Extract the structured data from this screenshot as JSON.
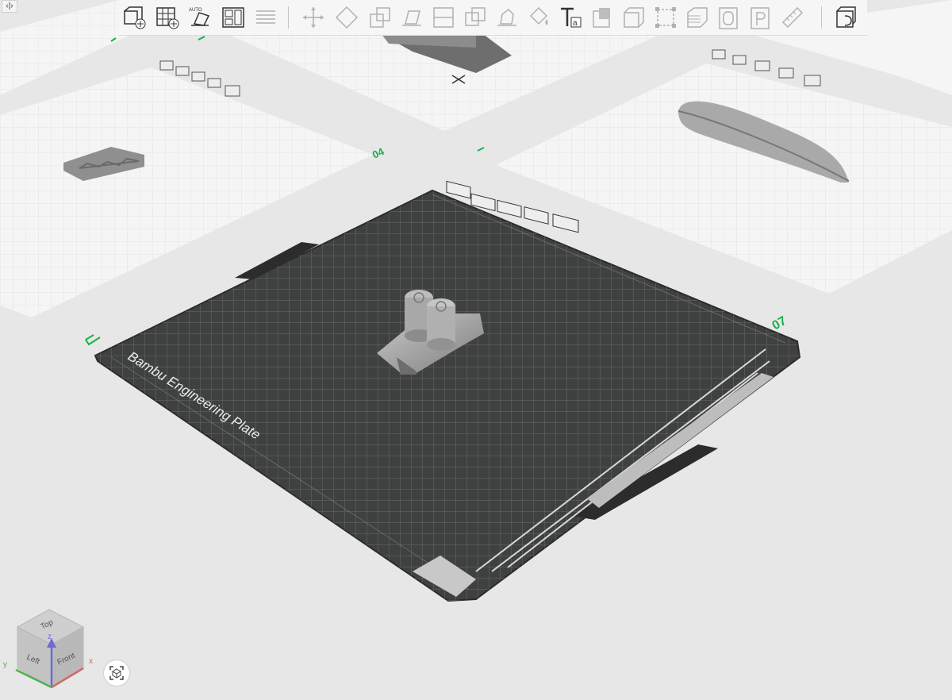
{
  "window": {
    "collapse_label": "‹|›"
  },
  "toolbar": {
    "items": [
      {
        "name": "add-object-icon",
        "enabled": true
      },
      {
        "name": "add-plate-icon",
        "enabled": true
      },
      {
        "name": "auto-orient-icon",
        "enabled": true,
        "badge": "AUTO"
      },
      {
        "name": "arrange-icon",
        "enabled": true
      },
      {
        "name": "split-layers-icon",
        "enabled": false
      },
      {
        "name": "move-icon",
        "enabled": false
      },
      {
        "name": "rotate-icon",
        "enabled": false
      },
      {
        "name": "scale-icon",
        "enabled": false
      },
      {
        "name": "lay-on-face-icon",
        "enabled": false
      },
      {
        "name": "cut-icon",
        "enabled": false
      },
      {
        "name": "boolean-icon",
        "enabled": false
      },
      {
        "name": "support-paint-icon",
        "enabled": false
      },
      {
        "name": "color-paint-icon",
        "enabled": false
      },
      {
        "name": "text-icon",
        "enabled": true
      },
      {
        "name": "emboss-icon",
        "enabled": false
      },
      {
        "name": "measure-box-icon",
        "enabled": false
      },
      {
        "name": "assembly-icon",
        "enabled": false
      },
      {
        "name": "layers-icon",
        "enabled": false
      },
      {
        "name": "variable-layer-icon",
        "enabled": false
      },
      {
        "name": "outline-o-icon",
        "enabled": false
      },
      {
        "name": "outline-p-icon",
        "enabled": false
      },
      {
        "name": "ruler-icon",
        "enabled": false
      },
      {
        "name": "slice-view-icon",
        "enabled": true
      }
    ]
  },
  "scene": {
    "plate_main": {
      "number": "07",
      "bed_text": "Bambu Engineering Plate",
      "status_icon_text": "✓"
    },
    "plate_left": {
      "number": "04"
    },
    "plate_control_icons": [
      "close-plate-icon",
      "lock-plate-icon",
      "plate-settings-icon",
      "plate-object-list-icon",
      "plate-auto-arrange-icon"
    ]
  },
  "navcube": {
    "top": "Top",
    "left": "Left",
    "front": "Front",
    "axis_x": "x",
    "axis_y": "y",
    "axis_z": "z"
  },
  "colors": {
    "bed": "#3f4140",
    "bed_grid": "#6b6d6c",
    "inactive_plate": "#f5f5f5",
    "plate_number": "#18b04a",
    "model": "#9a9a9a"
  }
}
